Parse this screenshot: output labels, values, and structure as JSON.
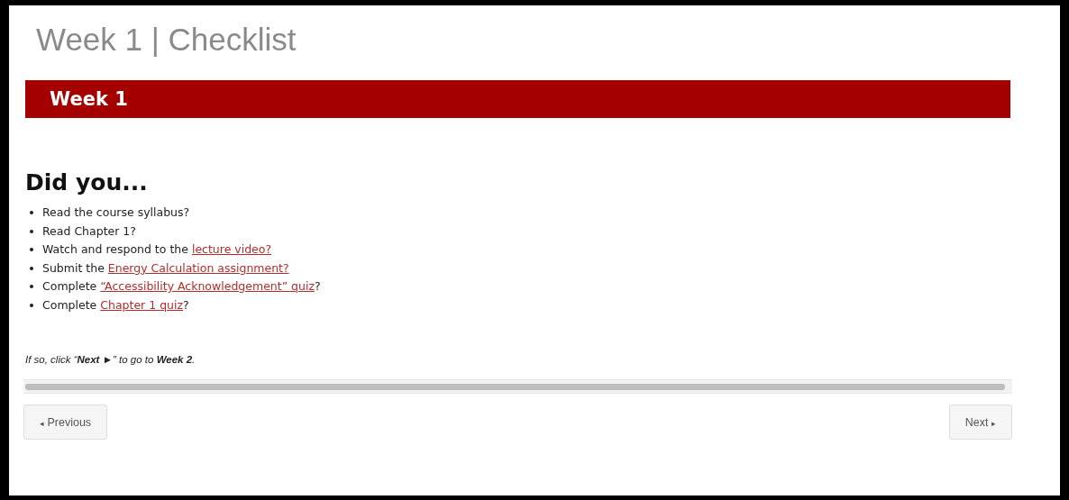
{
  "page_title": "Week 1 | Checklist",
  "banner": "Week 1",
  "heading": "Did you...",
  "items": [
    {
      "text": "Read the course syllabus?"
    },
    {
      "text": "Read Chapter 1?"
    },
    {
      "text": "Watch and respond to the",
      "link": "lecture video?"
    },
    {
      "text": "Submit the",
      "link": "Energy Calculation assignment?"
    },
    {
      "text": "Complete",
      "link": "“Accessibility Acknowledgement” quiz",
      "after": "?"
    },
    {
      "text": "Complete",
      "link": "Chapter 1 quiz",
      "after": "?"
    }
  ],
  "instruction": "If so, click “**Next ►**” to go to **Week 2**.",
  "nav": {
    "previous": {
      "icon": "◂",
      "label": "Previous"
    },
    "next": {
      "label": "Next",
      "icon": "▸"
    }
  }
}
